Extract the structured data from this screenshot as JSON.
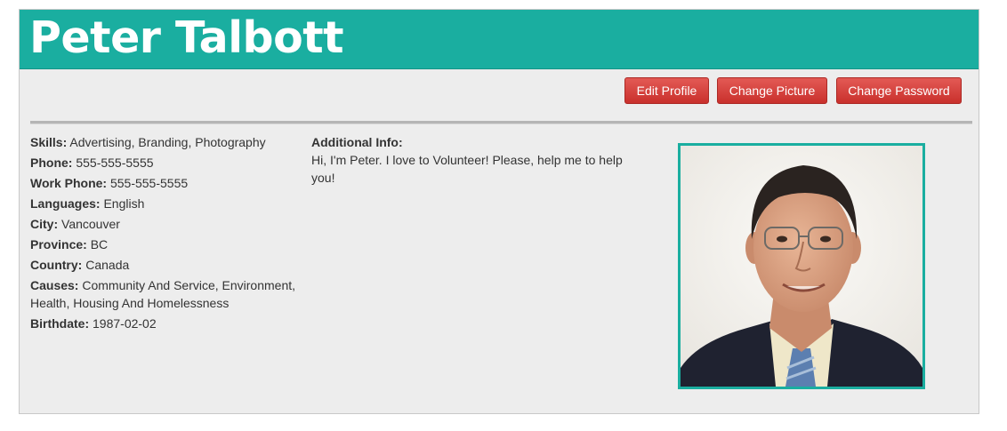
{
  "profile": {
    "name": "Peter Talbott"
  },
  "actions": {
    "edit_profile": "Edit Profile",
    "change_picture": "Change Picture",
    "change_password": "Change Password"
  },
  "details": {
    "skills_label": "Skills:",
    "skills": "Advertising, Branding, Photography",
    "phone_label": "Phone:",
    "phone": "555-555-5555",
    "work_phone_label": "Work Phone:",
    "work_phone": "555-555-5555",
    "languages_label": "Languages:",
    "languages": "English",
    "city_label": "City:",
    "city": "Vancouver",
    "province_label": "Province:",
    "province": "BC",
    "country_label": "Country:",
    "country": "Canada",
    "causes_label": "Causes:",
    "causes": "Community And Service, Environment, Health, Housing And Homelessness",
    "birthdate_label": "Birthdate:",
    "birthdate": "1987-02-02"
  },
  "additional_info": {
    "label": "Additional Info:",
    "text": "Hi, I'm Peter. I love to Volunteer! Please, help me to help you!"
  },
  "colors": {
    "accent": "#1aaea0",
    "button": "#d9534f",
    "panel": "#ededed"
  }
}
